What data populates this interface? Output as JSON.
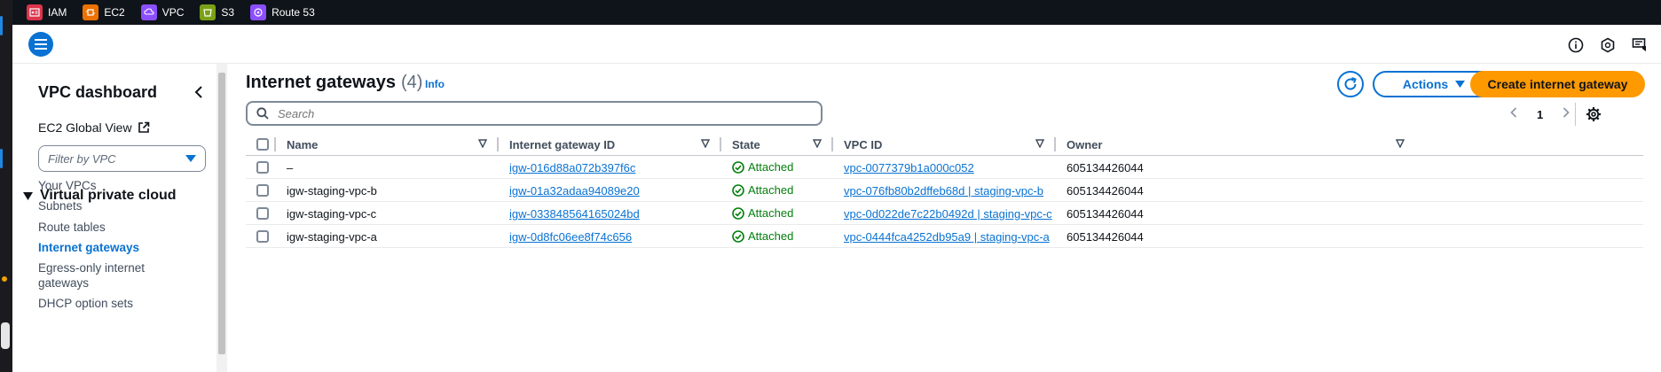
{
  "favorites": [
    {
      "label": "IAM",
      "icon": "iam-icon",
      "color": "#dd344c"
    },
    {
      "label": "EC2",
      "icon": "ec2-icon",
      "color": "#ed7100"
    },
    {
      "label": "VPC",
      "icon": "vpc-icon",
      "color": "#8c4fff"
    },
    {
      "label": "S3",
      "icon": "s3-icon",
      "color": "#7aa116"
    },
    {
      "label": "Route 53",
      "icon": "route53-icon",
      "color": "#8c4fff"
    }
  ],
  "sidebar": {
    "title": "VPC dashboard",
    "global_view": "EC2 Global View",
    "filter_placeholder": "Filter by VPC",
    "section": "Virtual private cloud",
    "items": [
      {
        "label": "Your VPCs"
      },
      {
        "label": "Subnets"
      },
      {
        "label": "Route tables"
      },
      {
        "label": "Internet gateways"
      },
      {
        "label": "Egress-only internet"
      },
      {
        "label": "gateways"
      },
      {
        "label": "DHCP option sets"
      }
    ]
  },
  "header": {
    "title": "Internet gateways",
    "count": "(4)",
    "info": "Info",
    "actions_label": "Actions",
    "create_label": "Create internet gateway",
    "search_placeholder": "Search",
    "page": "1"
  },
  "table": {
    "columns": [
      "Name",
      "Internet gateway ID",
      "State",
      "VPC ID",
      "Owner"
    ],
    "rows": [
      {
        "name": "–",
        "igw_id": "igw-016d88a072b397f6c",
        "state": "Attached",
        "vpc_id": "vpc-0077379b1a000c052",
        "owner": "605134426044"
      },
      {
        "name": "igw-staging-vpc-b",
        "igw_id": "igw-01a32adaa94089e20",
        "state": "Attached",
        "vpc_id": "vpc-076fb80b2dffeb68d | staging-vpc-b",
        "owner": "605134426044"
      },
      {
        "name": "igw-staging-vpc-c",
        "igw_id": "igw-033848564165024bd",
        "state": "Attached",
        "vpc_id": "vpc-0d022de7c22b0492d | staging-vpc-c",
        "owner": "605134426044"
      },
      {
        "name": "igw-staging-vpc-a",
        "igw_id": "igw-0d8fc06ee8f74c656",
        "state": "Attached",
        "vpc_id": "vpc-0444fca4252db95a9 | staging-vpc-a",
        "owner": "605134426044"
      }
    ]
  },
  "colors": {
    "accent": "#0972d3",
    "primary_button": "#ff9900",
    "success": "#037f0c",
    "nav_bar": "#0f141a"
  }
}
